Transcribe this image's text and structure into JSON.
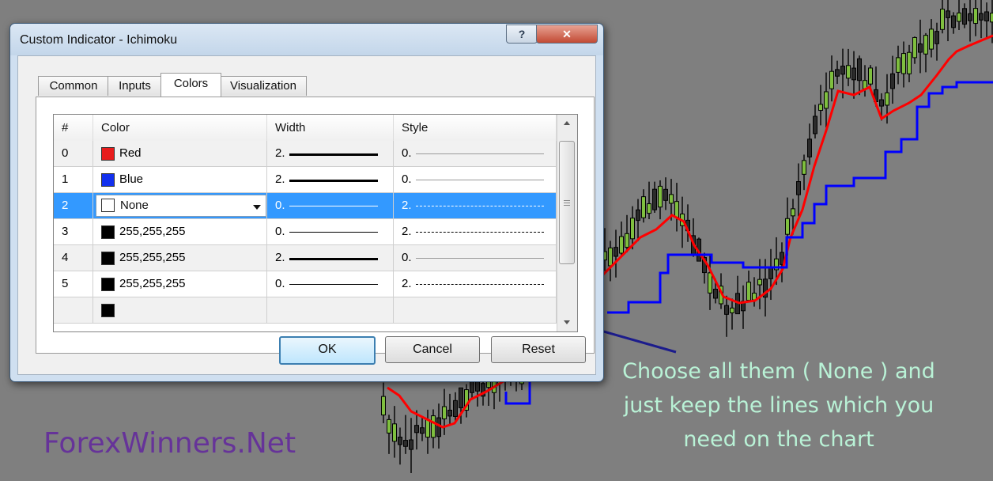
{
  "window": {
    "title": "Custom Indicator - Ichimoku",
    "help_label": "?",
    "close_label": "✕"
  },
  "tabs": [
    {
      "label": "Common",
      "active": false
    },
    {
      "label": "Inputs",
      "active": false
    },
    {
      "label": "Colors",
      "active": true
    },
    {
      "label": "Visualization",
      "active": false
    }
  ],
  "table": {
    "headers": [
      "#",
      "Color",
      "Width",
      "Style"
    ],
    "rows": [
      {
        "index": "0",
        "color_name": "Red",
        "swatch": "#e81c1c",
        "width": "2.",
        "style": "0.",
        "width_line": "thick",
        "style_line": "solid",
        "selected": false
      },
      {
        "index": "1",
        "color_name": "Blue",
        "swatch": "#1230ee",
        "width": "2.",
        "style": "0.",
        "width_line": "thick",
        "style_line": "solid",
        "selected": false
      },
      {
        "index": "2",
        "color_name": "None",
        "swatch": "#ffffff",
        "width": "0.",
        "style": "2.",
        "width_line": "thin",
        "style_line": "dashed",
        "selected": true
      },
      {
        "index": "3",
        "color_name": "255,255,255",
        "swatch": "#000000",
        "width": "0.",
        "style": "2.",
        "width_line": "thin",
        "style_line": "dashed",
        "selected": false
      },
      {
        "index": "4",
        "color_name": "255,255,255",
        "swatch": "#000000",
        "width": "2.",
        "style": "0.",
        "width_line": "thick",
        "style_line": "solid",
        "selected": false
      },
      {
        "index": "5",
        "color_name": "255,255,255",
        "swatch": "#000000",
        "width": "0.",
        "style": "2.",
        "width_line": "thin",
        "style_line": "dashed",
        "selected": false
      }
    ]
  },
  "buttons": {
    "ok": "OK",
    "cancel": "Cancel",
    "reset": "Reset"
  },
  "annotation": {
    "line1": "Choose all them ( None ) and",
    "line2": "just keep the lines which you",
    "line3": "need on the chart",
    "color": "#b9f2d6",
    "arrow_color": "#1c1c8c"
  },
  "watermark": "ForexWinners.Net",
  "colors": {
    "background": "#7f7f7f",
    "tenkan_line": "#ff0000",
    "kijun_line": "#0000ff",
    "selection": "#3399ff"
  }
}
